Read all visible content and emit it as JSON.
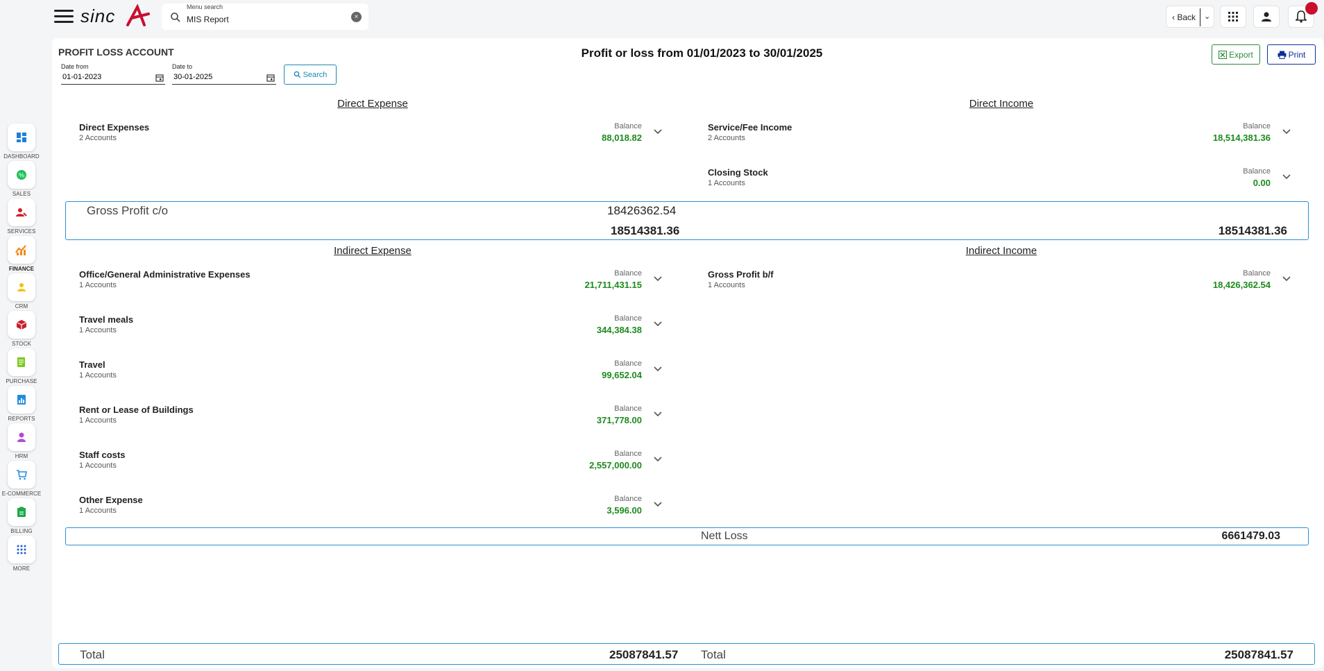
{
  "header": {
    "search_label": "Menu search",
    "search_value": "MIS Report",
    "back_label": "Back"
  },
  "colors": {
    "accent_blue": "#2a8fd8",
    "balance_green": "#1d8a1d",
    "logo_red": "#c8102e",
    "print_blue": "#0b2f9c",
    "export_green": "#2c8a3c"
  },
  "sidebar": {
    "items": [
      {
        "label": "DASHBOARD",
        "icon": "dashboard-icon"
      },
      {
        "label": "SALES",
        "icon": "sales-icon"
      },
      {
        "label": "SERVICES",
        "icon": "services-icon"
      },
      {
        "label": "FINANCE",
        "icon": "finance-icon"
      },
      {
        "label": "CRM",
        "icon": "crm-icon"
      },
      {
        "label": "STOCK",
        "icon": "stock-icon"
      },
      {
        "label": "PURCHASE",
        "icon": "purchase-icon"
      },
      {
        "label": "REPORTS",
        "icon": "reports-icon"
      },
      {
        "label": "HRM",
        "icon": "hrm-icon"
      },
      {
        "label": "E-COMMERCE",
        "icon": "ecommerce-icon"
      },
      {
        "label": "BILLING",
        "icon": "billing-icon"
      },
      {
        "label": "MORE",
        "icon": "more-icon"
      }
    ]
  },
  "page": {
    "title": "PROFIT LOSS ACCOUNT",
    "heading": "Profit or loss from 01/01/2023 to 30/01/2025",
    "date_from_label": "Date from",
    "date_from_value": "01-01-2023",
    "date_to_label": "Date to",
    "date_to_value": "30-01-2025",
    "search_btn": "Search",
    "export_btn": "Export",
    "print_btn": "Print"
  },
  "sections": {
    "direct_expense": "Direct Expense",
    "direct_income": "Direct Income",
    "indirect_expense": "Indirect Expense",
    "indirect_income": "Indirect Income"
  },
  "balance_label": "Balance",
  "direct_expenses": [
    {
      "name": "Direct Expenses",
      "count": "2 Accounts",
      "balance": "88,018.82"
    }
  ],
  "direct_income": [
    {
      "name": "Service/Fee Income",
      "count": "2 Accounts",
      "balance": "18,514,381.36"
    },
    {
      "name": "Closing Stock",
      "count": "1 Accounts",
      "balance": "0.00"
    }
  ],
  "gross_profit": {
    "label": "Gross Profit c/o",
    "value": "18426362.54",
    "left_sum": "18514381.36",
    "right_sum": "18514381.36"
  },
  "indirect_expenses": [
    {
      "name": "Office/General Administrative Expenses",
      "count": "1 Accounts",
      "balance": "21,711,431.15"
    },
    {
      "name": "Travel meals",
      "count": "1 Accounts",
      "balance": "344,384.38"
    },
    {
      "name": "Travel",
      "count": "1 Accounts",
      "balance": "99,652.04"
    },
    {
      "name": "Rent or Lease of Buildings",
      "count": "1 Accounts",
      "balance": "371,778.00"
    },
    {
      "name": "Staff costs",
      "count": "1 Accounts",
      "balance": "2,557,000.00"
    },
    {
      "name": "Other Expense",
      "count": "1 Accounts",
      "balance": "3,596.00"
    }
  ],
  "indirect_income": [
    {
      "name": "Gross Profit b/f",
      "count": "1 Accounts",
      "balance": "18,426,362.54"
    }
  ],
  "nett_loss": {
    "label": "Nett Loss",
    "value": "6661479.03"
  },
  "totals": {
    "left_label": "Total",
    "left_value": "25087841.57",
    "right_label": "Total",
    "right_value": "25087841.57"
  }
}
